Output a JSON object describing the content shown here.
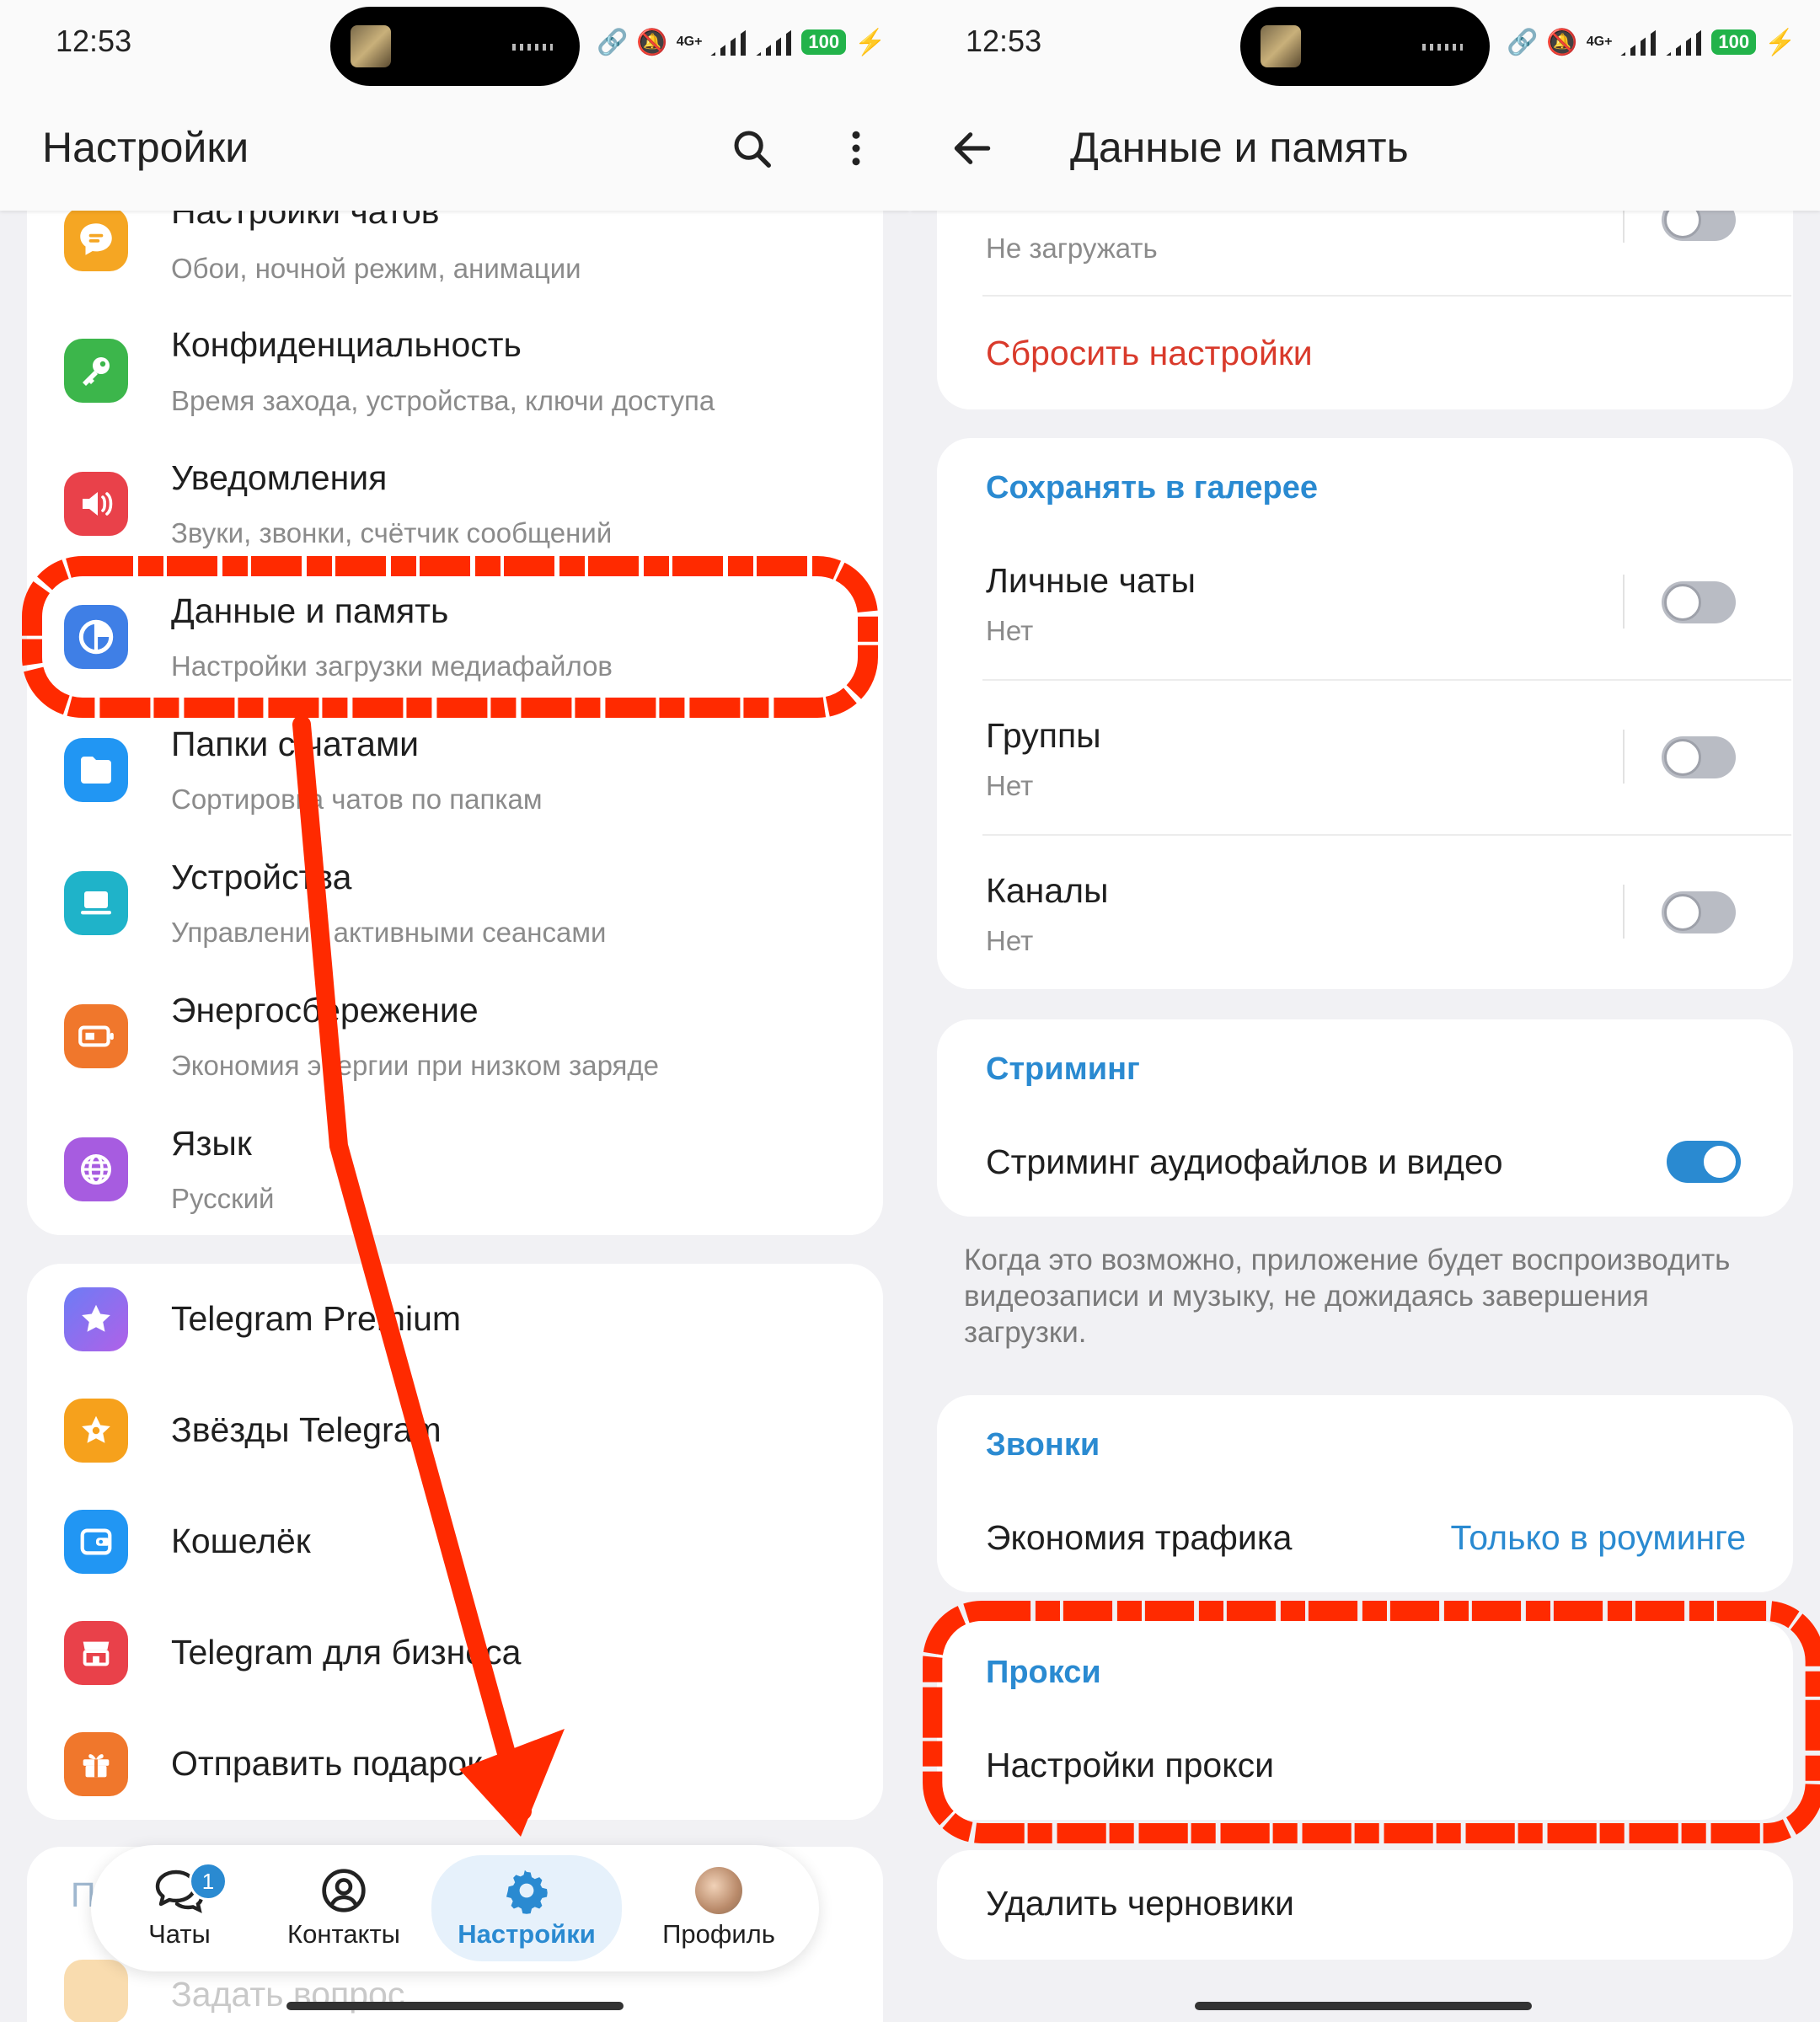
{
  "status": {
    "time": "12:53",
    "network": "4G+",
    "battery": "100"
  },
  "left": {
    "title": "Настройки",
    "partial_top_item": {
      "label": "Настройки чатов",
      "sub": "Обои, ночной режим, анимации"
    },
    "items": [
      {
        "label": "Конфиденциальность",
        "sub": "Время захода, устройства, ключи доступа"
      },
      {
        "label": "Уведомления",
        "sub": "Звуки, звонки, счётчик сообщений"
      },
      {
        "label": "Данные и память",
        "sub": "Настройки загрузки медиафайлов"
      },
      {
        "label": "Папки с чатами",
        "sub": "Сортировка чатов по папкам"
      },
      {
        "label": "Устройства",
        "sub": "Управление активными сеансами"
      },
      {
        "label": "Энергосбережение",
        "sub": "Экономия энергии при низком заряде"
      },
      {
        "label": "Язык",
        "sub": "Русский"
      }
    ],
    "items2": [
      {
        "label": "Telegram Premium"
      },
      {
        "label": "Звёзды Telegram"
      },
      {
        "label": "Кошелёк"
      },
      {
        "label": "Telegram для бизнеса"
      },
      {
        "label": "Отправить подарок"
      }
    ],
    "partial_bottom_item": "Задать вопрос",
    "partial_left_letter": "П",
    "nav": [
      {
        "label": "Чаты",
        "badge": "1"
      },
      {
        "label": "Контакты"
      },
      {
        "label": "Настройки"
      },
      {
        "label": "Профиль"
      }
    ]
  },
  "right": {
    "title": "Данные и память",
    "top_partial": {
      "sub": "Не загружать"
    },
    "reset": "Сбросить настройки",
    "gallery": {
      "header": "Сохранять в галерее",
      "rows": [
        {
          "label": "Личные чаты",
          "sub": "Нет"
        },
        {
          "label": "Группы",
          "sub": "Нет"
        },
        {
          "label": "Каналы",
          "sub": "Нет"
        }
      ]
    },
    "streaming": {
      "header": "Стриминг",
      "label": "Стриминг аудиофайлов и видео",
      "note": "Когда это возможно, приложение будет воспроизводить видеозаписи и музыку, не дожидаясь завершения загрузки."
    },
    "calls": {
      "header": "Звонки",
      "label": "Экономия трафика",
      "value": "Только в роуминге"
    },
    "proxy": {
      "header": "Прокси",
      "label": "Настройки прокси"
    },
    "delete_drafts": "Удалить черновики"
  },
  "colors": {
    "accent": "#2a8ad1",
    "danger": "#d93a2b",
    "annotation": "#ff2a00"
  }
}
